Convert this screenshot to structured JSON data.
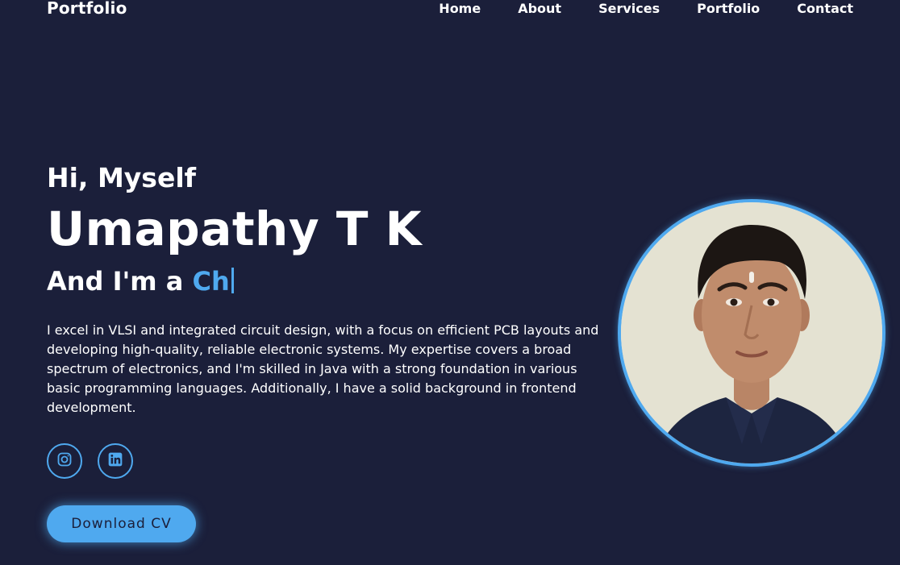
{
  "header": {
    "logo": "Portfolio",
    "nav": [
      "Home",
      "About",
      "Services",
      "Portfolio",
      "Contact"
    ]
  },
  "hero": {
    "greeting": "Hi, Myself",
    "name": "Umapathy T K",
    "role_prefix": "And I'm a ",
    "role_typed": "Ch",
    "bio": "I excel in VLSI and integrated circuit design, with a focus on efficient PCB layouts and developing high-quality, reliable electronic systems. My expertise covers a broad spectrum of electronics, and I'm skilled in Java with a strong foundation in various basic programming languages. Additionally, I have a solid background in frontend development.",
    "socials": [
      {
        "icon": "instagram-icon"
      },
      {
        "icon": "linkedin-icon"
      }
    ],
    "cv_button": "Download CV",
    "photo": {
      "icon": "profile-photo"
    }
  },
  "colors": {
    "background": "#1b1f3a",
    "accent": "#4fa9ef",
    "text": "#ffffff"
  }
}
